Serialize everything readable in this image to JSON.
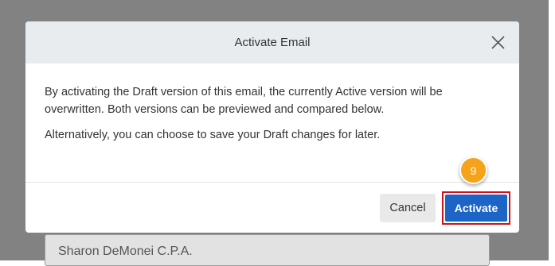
{
  "background": {
    "field_value": "Sharon DeMonei C.P.A."
  },
  "dialog": {
    "title": "Activate Email",
    "paragraph_1": "By activating the Draft version of this email, the currently Active version will be overwritten. Both versions can be previewed and compared below.",
    "paragraph_2": "Alternatively, you can choose to save your Draft changes for later.",
    "cancel_label": "Cancel",
    "activate_label": "Activate"
  },
  "annotation": {
    "step_number": "9"
  },
  "colors": {
    "primary_button": "#1c64c6",
    "highlight_border": "#d0101a",
    "step_badge": "#f4a31a",
    "header_background": "#e9ecef"
  },
  "icons": {
    "close": "close-icon"
  }
}
